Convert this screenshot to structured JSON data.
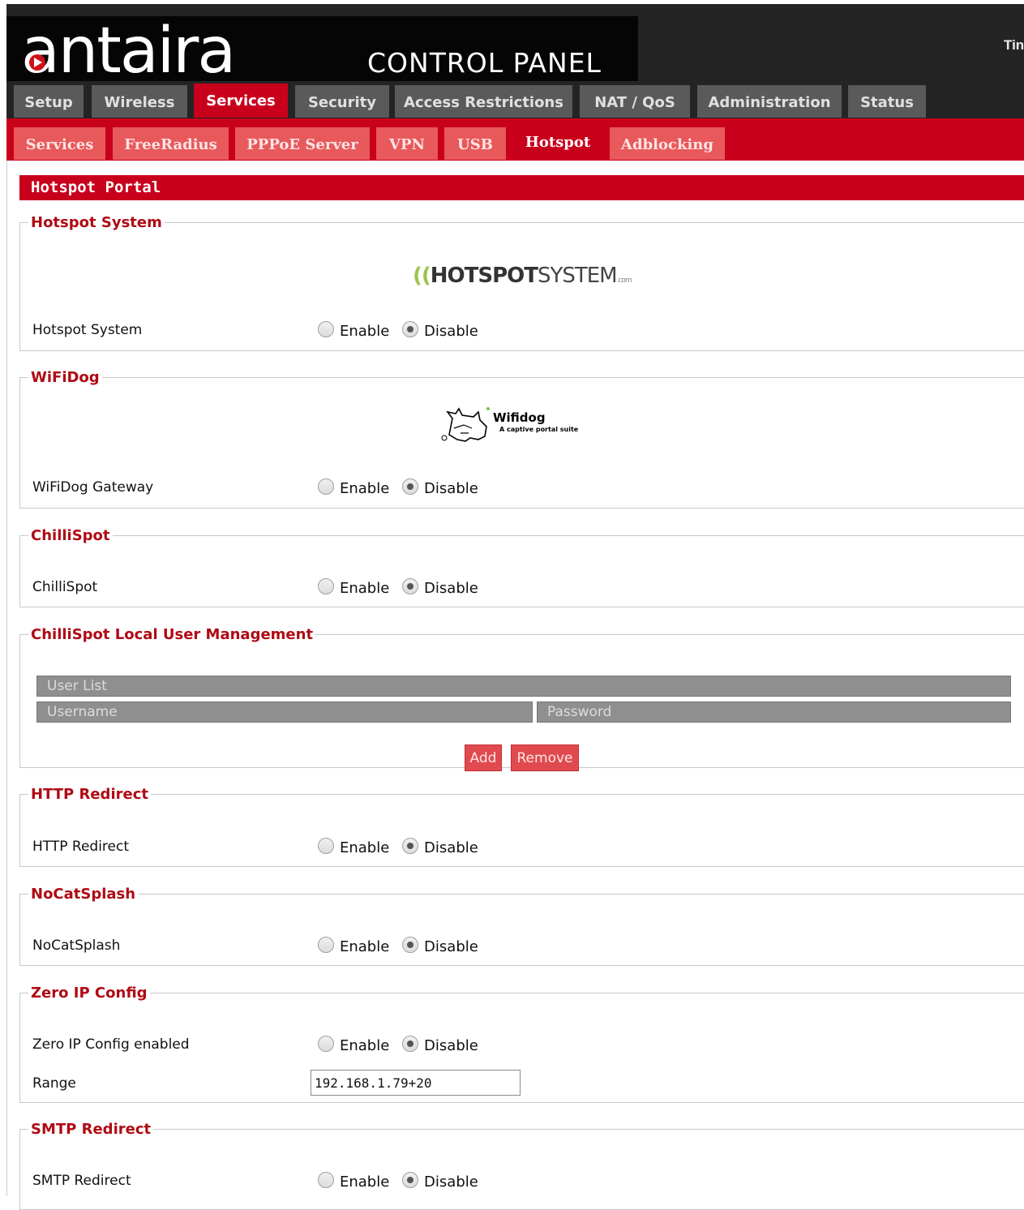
{
  "header": {
    "logo_text": "antaira",
    "title": "CONTROL PANEL",
    "time_label": "Tin"
  },
  "main_tabs": [
    {
      "label": "Setup"
    },
    {
      "label": "Wireless"
    },
    {
      "label": "Services"
    },
    {
      "label": "Security"
    },
    {
      "label": "Access Restrictions"
    },
    {
      "label": "NAT / QoS"
    },
    {
      "label": "Administration"
    },
    {
      "label": "Status"
    }
  ],
  "sub_tabs": [
    {
      "label": "Services"
    },
    {
      "label": "FreeRadius"
    },
    {
      "label": "PPPoE Server"
    },
    {
      "label": "VPN"
    },
    {
      "label": "USB"
    },
    {
      "label": "Hotspot"
    },
    {
      "label": "Adblocking"
    }
  ],
  "page_header": "Hotspot Portal",
  "radio_labels": {
    "enable": "Enable",
    "disable": "Disable"
  },
  "sections": {
    "hotspot_system": {
      "legend": "Hotspot System",
      "logo": {
        "waves": "((",
        "bold": "HOTSPOT",
        "rest": "SYSTEM",
        "suffix": ".com"
      },
      "row_label": "Hotspot System",
      "value": "Disable"
    },
    "wifidog": {
      "legend": "WiFiDog",
      "logo": {
        "name": "Wifidog",
        "tagline": "A captive portal suite"
      },
      "row_label": "WiFiDog Gateway",
      "value": "Disable"
    },
    "chillispot": {
      "legend": "ChilliSpot",
      "row_label": "ChilliSpot",
      "value": "Disable"
    },
    "chillispot_users": {
      "legend": "ChilliSpot Local User Management",
      "table_title": "User List",
      "columns": [
        "Username",
        "Password"
      ],
      "add_button": "Add",
      "remove_button": "Remove"
    },
    "http_redirect": {
      "legend": "HTTP Redirect",
      "row_label": "HTTP Redirect",
      "value": "Disable"
    },
    "nocatsplash": {
      "legend": "NoCatSplash",
      "row_label": "NoCatSplash",
      "value": "Disable"
    },
    "zero_ip": {
      "legend": "Zero IP Config",
      "row_label": "Zero IP Config enabled",
      "value": "Disable",
      "range_label": "Range",
      "range_value": "192.168.1.79+20"
    },
    "smtp_redirect": {
      "legend": "SMTP Redirect",
      "row_label": "SMTP Redirect",
      "value": "Disable"
    }
  }
}
